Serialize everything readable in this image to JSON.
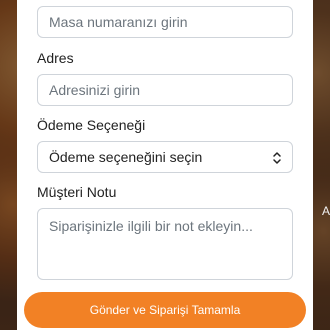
{
  "form": {
    "table_number": {
      "placeholder": "Masa numaranızı girin"
    },
    "address": {
      "label": "Adres",
      "placeholder": "Adresinizi girin"
    },
    "payment": {
      "label": "Ödeme Seçeneği",
      "selected": "Ödeme seçeneğini seçin"
    },
    "customer_note": {
      "label": "Müşteri Notu",
      "placeholder": "Siparişinizle ilgili bir not ekleyin..."
    },
    "submit_label": "Gönder ve Siparişi Tamamla"
  },
  "background": {
    "right_edge_fragment": "A"
  },
  "colors": {
    "accent": "#f28125",
    "field_border": "#cfd4da",
    "placeholder": "#6c757d"
  }
}
